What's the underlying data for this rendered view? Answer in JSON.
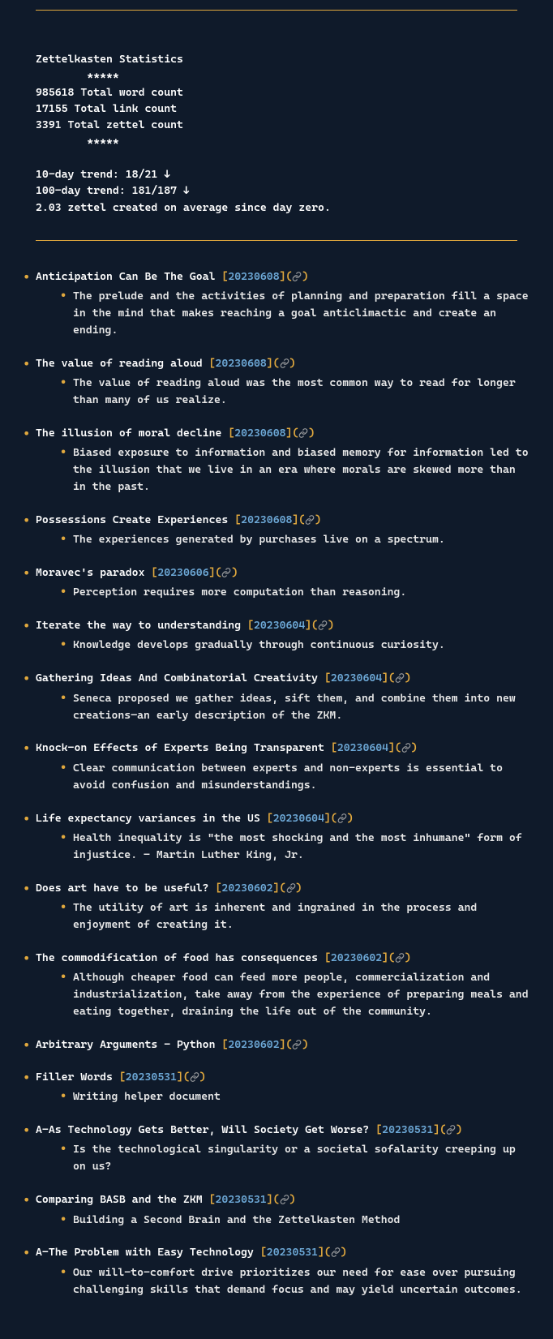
{
  "stats": {
    "title": "Zettelkasten Statistics",
    "stars": "*****",
    "word_count": "985618 Total word count",
    "link_count": "17155 Total link count",
    "zettel_count": "3391 Total zettel count",
    "trend_10": "10-day trend: 18/21 ↓",
    "trend_100": "100-day trend: 181/187 ↓",
    "avg": "2.03 zettel created on average since day zero."
  },
  "entries": [
    {
      "title": "Anticipation Can Be The Goal",
      "date": "20230608",
      "desc": "The prelude and the activities of planning and preparation fill a space in the mind that makes reaching a goal anticlimactic and create an ending."
    },
    {
      "title": "The value of reading aloud",
      "date": "20230608",
      "desc": "The value of reading aloud was the most common way to read for longer than many of us realize."
    },
    {
      "title": "The illusion of moral decline",
      "date": "20230608",
      "desc": "Biased exposure to information and biased memory for information led to the illusion that we live in an era where morals are skewed more than in the past."
    },
    {
      "title": "Possessions Create Experiences",
      "date": "20230608",
      "desc": "The experiences generated by purchases live on a spectrum."
    },
    {
      "title": "Moravec's paradox",
      "date": "20230606",
      "desc": "Perception requires more computation than reasoning."
    },
    {
      "title": "Iterate the way to understanding",
      "date": "20230604",
      "desc": "Knowledge develops gradually through continuous curiosity."
    },
    {
      "title": "Gathering Ideas And Combinatorial Creativity",
      "date": "20230604",
      "desc": "Seneca proposed we gather ideas, sift them, and combine them into new creations—an early description of the ZKM."
    },
    {
      "title": "Knock-on Effects of Experts Being Transparent",
      "date": "20230604",
      "desc": "Clear communication between experts and non-experts is essential to avoid confusion and misunderstandings."
    },
    {
      "title": "Life expectancy variances in the US",
      "date": "20230604",
      "desc": "Health inequality is \"the most shocking and the most inhumane\" form of injustice. – Martin Luther King, Jr."
    },
    {
      "title": "Does art have to be useful?",
      "date": "20230602",
      "desc": "The utility of art is inherent and ingrained in the process and enjoyment of creating it."
    },
    {
      "title": "The commodification of food has consequences",
      "date": "20230602",
      "desc": "Although cheaper food can feed more people, commercialization and industrialization, take away from the experience of preparing meals and eating together, draining the life out of the community."
    },
    {
      "title": "Arbitrary Arguments - Python",
      "date": "20230602"
    },
    {
      "title": "Filler Words",
      "date": "20230531",
      "desc": "Writing helper document"
    },
    {
      "title": "A-As Technology Gets Better, Will Society Get Worse?",
      "date": "20230531",
      "desc": "Is the technological singularity or a societal sofalarity creeping up on us?"
    },
    {
      "title": "Comparing BASB and the ZKM",
      "date": "20230531",
      "desc": "Building a Second Brain and the Zettelkasten Method"
    },
    {
      "title": "A-The Problem with Easy Technology",
      "date": "20230531",
      "desc": "Our will-to-comfort drive prioritizes our need for ease over pursuing challenging skills that demand focus and may yield uncertain outcomes."
    }
  ]
}
